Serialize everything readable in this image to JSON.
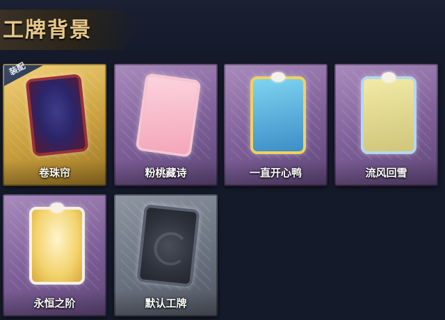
{
  "header": {
    "title": "工牌背景"
  },
  "cards": [
    {
      "name": "卷珠帘",
      "equipped": true,
      "badge": "装配"
    },
    {
      "name": "粉桃藏诗",
      "equipped": false
    },
    {
      "name": "一直开心鸭",
      "equipped": false
    },
    {
      "name": "流风回雪",
      "equipped": false
    },
    {
      "name": "永恒之阶",
      "equipped": false
    },
    {
      "name": "默认工牌",
      "equipped": false
    }
  ]
}
